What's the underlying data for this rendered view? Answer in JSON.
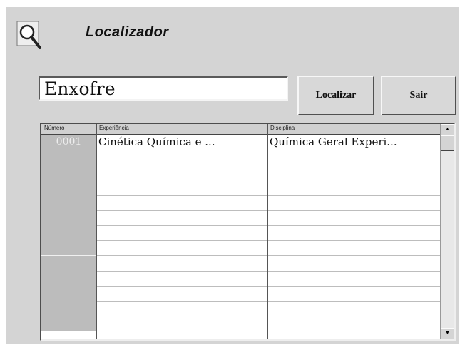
{
  "window": {
    "title": "Localizador",
    "icon": "magnifier-icon"
  },
  "search": {
    "value": "Enxofre",
    "find_label": "Localizar",
    "exit_label": "Sair"
  },
  "grid": {
    "headers": [
      "Número",
      "Experiência",
      "Disciplina"
    ],
    "rows": [
      {
        "numero": "0001",
        "experiencia": "Cinética Química e ...",
        "disciplina": "Química Geral Experi..."
      }
    ],
    "empty_rows": 12
  },
  "scrollbar": {
    "up_icon": "arrow-up-icon",
    "down_icon": "arrow-down-icon"
  }
}
